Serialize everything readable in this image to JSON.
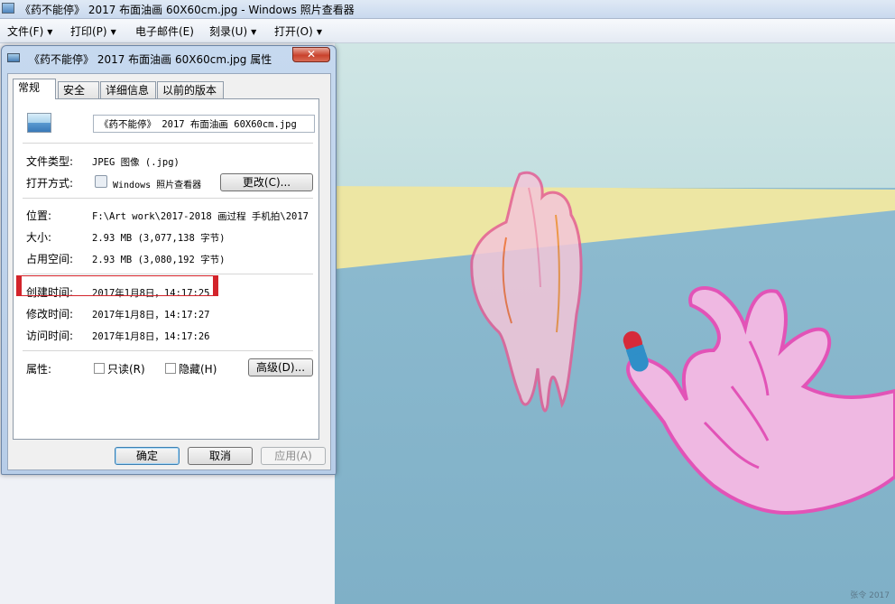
{
  "window": {
    "title": "《药不能停》 2017 布面油画 60X60cm.jpg - Windows 照片查看器"
  },
  "menu": [
    {
      "label": "文件(F)"
    },
    {
      "label": "打印(P)"
    },
    {
      "label": "电子邮件(E)"
    },
    {
      "label": "刻录(U)"
    },
    {
      "label": "打开(O)"
    }
  ],
  "dialog": {
    "title": "《药不能停》 2017 布面油画 60X60cm.jpg 属性",
    "close_label": "✕",
    "tabs": [
      "常规",
      "安全",
      "详细信息",
      "以前的版本"
    ],
    "filename": "《药不能停》 2017 布面油画 60X60cm.jpg",
    "file_type_label": "文件类型:",
    "file_type_value": "JPEG 图像 (.jpg)",
    "open_with_label": "打开方式:",
    "open_with_value": "Windows 照片查看器",
    "change_button": "更改(C)...",
    "location_label": "位置:",
    "location_value": "F:\\Art work\\2017-2018 画过程 手机拍\\2017",
    "size_label": "大小:",
    "size_value": "2.93 MB (3,077,138 字节)",
    "disk_size_label": "占用空间:",
    "disk_size_value": "2.93 MB (3,080,192 字节)",
    "created_label": "创建时间:",
    "created_value": "2017年1月8日，14:17:25",
    "modified_label": "修改时间:",
    "modified_value": "2017年1月8日，14:17:27",
    "accessed_label": "访问时间:",
    "accessed_value": "2017年1月8日，14:17:26",
    "attributes_label": "属性:",
    "readonly_label": "只读(R)",
    "hidden_label": "隐藏(H)",
    "advanced_button": "高级(D)...",
    "ok_button": "确定",
    "cancel_button": "取消",
    "apply_button": "应用(A)"
  },
  "painting": {
    "signature": "张令 2017"
  }
}
